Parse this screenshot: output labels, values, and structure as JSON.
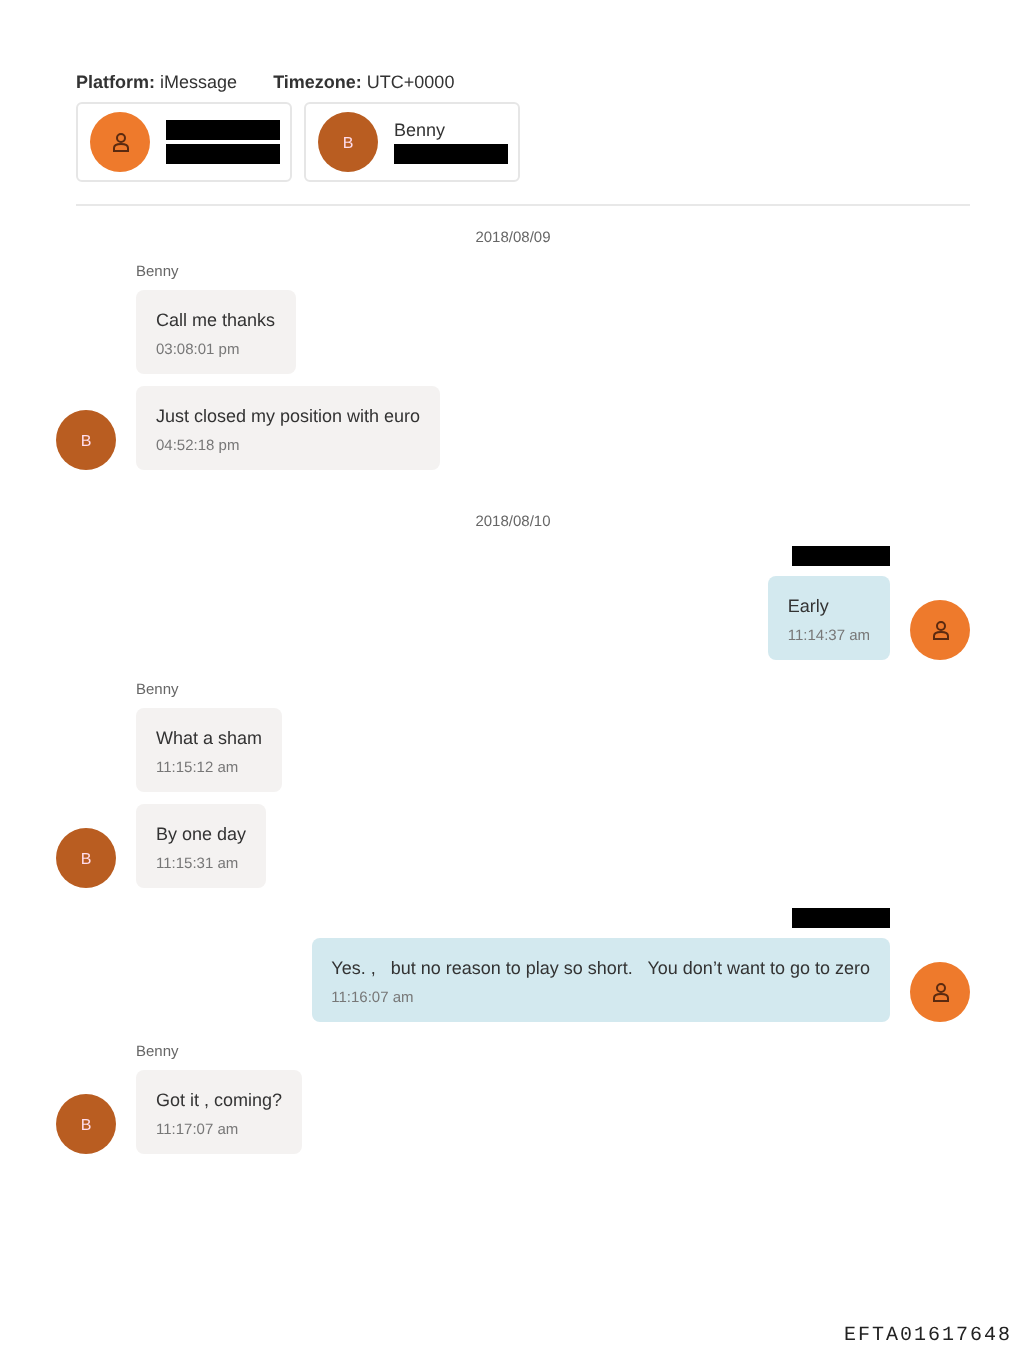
{
  "header": {
    "platform_label": "Platform:",
    "platform": "iMessage",
    "timezone_label": "Timezone:",
    "timezone": "UTC+0000"
  },
  "participants": [
    {
      "avatar": {
        "kind": "person"
      },
      "lines": [
        {
          "kind": "redacted"
        },
        {
          "kind": "redacted"
        }
      ]
    },
    {
      "avatar": {
        "kind": "letter",
        "initial": "B"
      },
      "lines": [
        {
          "kind": "text",
          "text": "Benny"
        },
        {
          "kind": "redacted"
        }
      ]
    }
  ],
  "items": [
    {
      "kind": "date",
      "text": "2018/08/09"
    },
    {
      "kind": "incoming",
      "sender": {
        "kind": "text",
        "text": "Benny"
      },
      "avatar": {
        "kind": "letter",
        "initial": "B"
      },
      "messages": [
        {
          "text": "Call me thanks",
          "time": "03:08:01 pm"
        },
        {
          "text": "Just closed my position with euro",
          "time": "04:52:18 pm"
        }
      ]
    },
    {
      "kind": "date",
      "text": "2018/08/10"
    },
    {
      "kind": "outgoing",
      "sender": {
        "kind": "redacted"
      },
      "avatar": {
        "kind": "person"
      },
      "messages": [
        {
          "text": "Early",
          "time": "11:14:37 am"
        }
      ]
    },
    {
      "kind": "incoming",
      "sender": {
        "kind": "text",
        "text": "Benny"
      },
      "avatar": {
        "kind": "letter",
        "initial": "B"
      },
      "messages": [
        {
          "text": "What a sham",
          "time": "11:15:12 am"
        },
        {
          "text": "By one day",
          "time": "11:15:31 am"
        }
      ]
    },
    {
      "kind": "outgoing",
      "sender": {
        "kind": "redacted"
      },
      "avatar": {
        "kind": "person"
      },
      "messages": [
        {
          "text": "Yes. ,   but no reason to play so short.   You don’t want to go to zero",
          "time": "11:16:07 am"
        }
      ]
    },
    {
      "kind": "incoming",
      "sender": {
        "kind": "text",
        "text": "Benny"
      },
      "avatar": {
        "kind": "letter",
        "initial": "B"
      },
      "messages": [
        {
          "text": "Got it , coming?",
          "time": "11:17:07 am"
        }
      ]
    }
  ],
  "footer": "EFTA01617648"
}
